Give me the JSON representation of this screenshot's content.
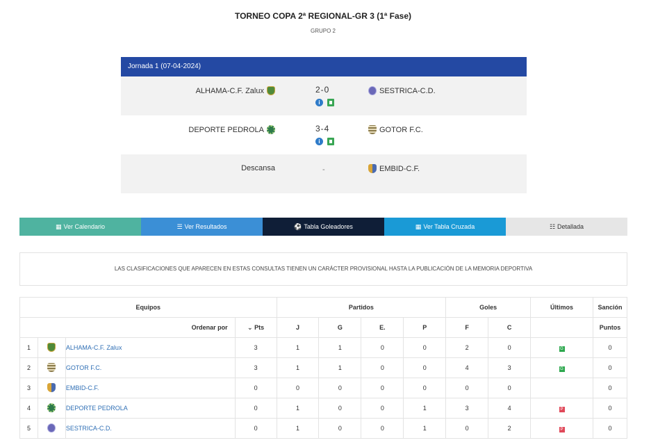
{
  "header": {
    "title": "TORNEO COPA 2ª REGIONAL-GR 3 (1ª Fase)",
    "subtitle": "GRUPO 2"
  },
  "matchday": {
    "label": "Jornada 1 (07-04-2024)",
    "matches": [
      {
        "home": "ALHAMA-C.F. Zalux",
        "home_crest": "alhama-crest-icon",
        "score": "2-0",
        "away": "SESTRICA-C.D.",
        "away_crest": "sestrica-crest-icon"
      },
      {
        "home": "DEPORTE PEDROLA",
        "home_crest": "pedrola-crest-icon",
        "score": "3-4",
        "away": "GOTOR F.C.",
        "away_crest": "gotor-crest-icon"
      }
    ],
    "rest": {
      "label": "Descansa",
      "dash": "-",
      "team": "EMBID-C.F.",
      "crest": "embid-crest-icon"
    }
  },
  "tabs": [
    {
      "label": "Ver Calendario",
      "icon": "calendar-icon",
      "color": "#4fb3a0"
    },
    {
      "label": "Ver Resultados",
      "icon": "list-icon",
      "color": "#3b8fd6"
    },
    {
      "label": "Tabla Goleadores",
      "icon": "soccer-ball-icon",
      "color": "#0f1e37"
    },
    {
      "label": "Ver Tabla Cruzada",
      "icon": "grid-icon",
      "color": "#1a9ad6"
    },
    {
      "label": "Detallada",
      "icon": "detail-list-icon",
      "color": "#e6e6e6"
    }
  ],
  "notice": "LAS CLASIFICACIONES QUE APARECEN EN ESTAS CONSULTAS TIENEN UN CARÁCTER PROVISIONAL HASTA LA PUBLICACIÓN DE LA MEMORIA DEPORTIVA",
  "standings": {
    "groups": {
      "equipos": "Equipos",
      "partidos": "Partidos",
      "goles": "Goles",
      "ultimos": "Últimos",
      "sancion": "Sanción"
    },
    "sort_label": "Ordenar por",
    "columns": {
      "pts": "Pts",
      "j": "J",
      "g": "G",
      "e": "E.",
      "p": "P",
      "f": "F",
      "c": "C",
      "puntos": "Puntos"
    },
    "rows": [
      {
        "pos": "1",
        "team": "ALHAMA-C.F. Zalux",
        "crest": "alhama-crest-icon",
        "pts": "3",
        "j": "1",
        "g": "1",
        "e": "0",
        "p": "0",
        "f": "2",
        "c": "0",
        "last": "G",
        "sancion": "0"
      },
      {
        "pos": "2",
        "team": "GOTOR F.C.",
        "crest": "gotor-crest-icon",
        "pts": "3",
        "j": "1",
        "g": "1",
        "e": "0",
        "p": "0",
        "f": "4",
        "c": "3",
        "last": "G",
        "sancion": "0"
      },
      {
        "pos": "3",
        "team": "EMBID-C.F.",
        "crest": "embid-crest-icon",
        "pts": "0",
        "j": "0",
        "g": "0",
        "e": "0",
        "p": "0",
        "f": "0",
        "c": "0",
        "last": "",
        "sancion": "0"
      },
      {
        "pos": "4",
        "team": "DEPORTE PEDROLA",
        "crest": "pedrola-crest-icon",
        "pts": "0",
        "j": "1",
        "g": "0",
        "e": "0",
        "p": "1",
        "f": "3",
        "c": "4",
        "last": "P",
        "sancion": "0"
      },
      {
        "pos": "5",
        "team": "SESTRICA-C.D.",
        "crest": "sestrica-crest-icon",
        "pts": "0",
        "j": "1",
        "g": "0",
        "e": "0",
        "p": "1",
        "f": "0",
        "c": "2",
        "last": "P",
        "sancion": "0"
      }
    ]
  }
}
